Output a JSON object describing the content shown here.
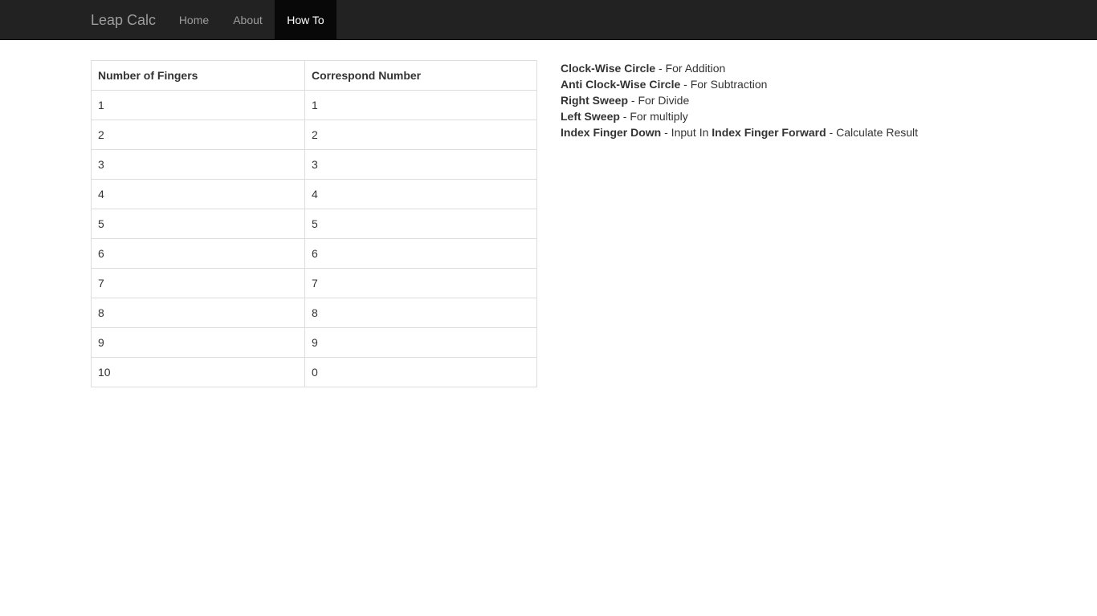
{
  "navbar": {
    "brand": "Leap Calc",
    "items": [
      {
        "label": "Home",
        "active": false
      },
      {
        "label": "About",
        "active": false
      },
      {
        "label": "How To",
        "active": true
      }
    ]
  },
  "table": {
    "headers": [
      "Number of Fingers",
      "Correspond Number"
    ],
    "rows": [
      [
        "1",
        "1"
      ],
      [
        "2",
        "2"
      ],
      [
        "3",
        "3"
      ],
      [
        "4",
        "4"
      ],
      [
        "5",
        "5"
      ],
      [
        "6",
        "6"
      ],
      [
        "7",
        "7"
      ],
      [
        "8",
        "8"
      ],
      [
        "9",
        "9"
      ],
      [
        "10",
        "0"
      ]
    ]
  },
  "gestures": [
    {
      "name": "Clock-Wise Circle",
      "desc": " - For Addition"
    },
    {
      "name": "Anti Clock-Wise Circle",
      "desc": " - For Subtraction"
    },
    {
      "name": "Right Sweep",
      "desc": " - For Divide"
    },
    {
      "name": "Left Sweep",
      "desc": " - For multiply"
    },
    {
      "name": "Index Finger Down",
      "desc": " - Input In ",
      "name2": "Index Finger Forward",
      "desc2": " - Calculate Result"
    }
  ],
  "colors": {
    "navbar_bg": "#222222",
    "navbar_active_bg": "#080808",
    "nav_text": "#9d9d9d",
    "table_border": "#dddddd"
  }
}
